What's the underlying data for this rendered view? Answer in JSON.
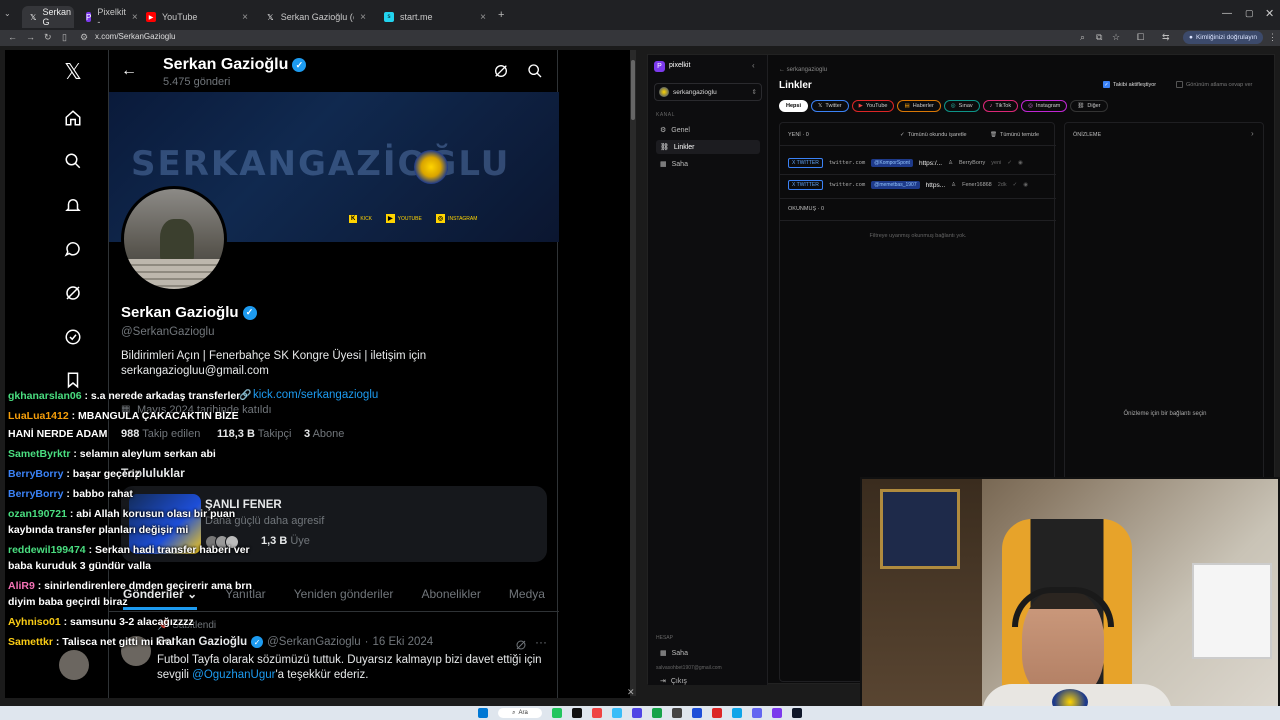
{
  "browser": {
    "tabs": [
      {
        "label": "Serkan G",
        "icon": "x-icon",
        "color": "#ffffff"
      },
      {
        "label": "Pixelkit -",
        "icon": "pixelkit-icon",
        "color": "#7c3aed"
      },
      {
        "label": "YouTube",
        "icon": "youtube-icon",
        "color": "#ff0000"
      },
      {
        "label": "Serkan Gazioğlu (@SerkanGazi",
        "icon": "x-icon",
        "color": "#ffffff"
      },
      {
        "label": "start.me",
        "icon": "startme-icon",
        "color": "#22d3ee"
      }
    ],
    "url": "x.com/SerkanGazioglu",
    "verify_label": "Kimliğinizi doğrulayın"
  },
  "profile": {
    "header_name": "Serkan Gazioğlu",
    "post_count": "5.475 gönderi",
    "banner_text": "SERKANGAZİOĞLU",
    "banner_socials": [
      "KICK",
      "YOUTUBE",
      "INSTAGRAM"
    ],
    "name": "Serkan Gazioğlu",
    "handle": "@SerkanGazioglu",
    "bio_line1": "Bildirimleri Açın | Fenerbahçe SK Kongre Üyesi | iletişim için",
    "bio_line2": "serkangaziogluu@gmail.com",
    "link": "kick.com/serkangazioglu",
    "joined": "Mayıs 2024 tarihinde katıldı",
    "following_count": "988",
    "following_label": "Takip edilen",
    "followers_count": "118,3 B",
    "followers_label": "Takipçi",
    "subs_count": "3",
    "subs_label": "Abone",
    "communities_label": "Topluluklar",
    "community_name": "ŞANLI FENER",
    "community_desc": "Daha güçlü daha agresif",
    "community_members": "1,3 B",
    "community_members_label": "Üye",
    "tabs": [
      "Gönderiler",
      "Yanıtlar",
      "Yeniden gönderiler",
      "Abonelikler",
      "Medya"
    ],
    "pinned_label": "Sabitlendi",
    "tweet_author": "Serkan Gazioğlu",
    "tweet_handle": "@SerkanGazioglu",
    "tweet_date": "16 Eki 2024",
    "tweet_line1": "Futbol Tayfa olarak sözümüzü tuttuk. Duyarsız kalmayıp bizi davet ettiği için",
    "tweet_line2_pre": "sevgili",
    "tweet_mention": "@OguzhanUgur",
    "tweet_line2_post": "'a teşekkür ederiz."
  },
  "chat": [
    {
      "user": "gkhanarslan06",
      "color": "#4ade80",
      "msg": ": s.a nerede arkadaş transferler"
    },
    {
      "user": "LuaLua1412",
      "color": "#f59e0b",
      "msg": ": MBANGULA ÇAKACAKTIN BİZE"
    },
    {
      "user": "",
      "color": "#ffffff",
      "msg": "HANİ NERDE ADAM"
    },
    {
      "user": "SametByrktr",
      "color": "#4ade80",
      "msg": ": selamın aleylum serkan abi"
    },
    {
      "user": "BerryBorry",
      "color": "#3b82f6",
      "msg": ": başar geçeriz"
    },
    {
      "user": "BerryBorry",
      "color": "#3b82f6",
      "msg": ": babbo rahat"
    },
    {
      "user": "ozan190721",
      "color": "#4ade80",
      "msg": ": abi Allah korusun olası bir puan"
    },
    {
      "user": "",
      "color": "#ffffff",
      "msg": "kaybında transfer planları değişir mi"
    },
    {
      "user": "reddewil199474",
      "color": "#4ade80",
      "msg": ": Serkan hadi transfer haberi ver"
    },
    {
      "user": "",
      "color": "#ffffff",
      "msg": "baba kuruduk 3 gündür valla"
    },
    {
      "user": "AliR9",
      "color": "#f472b6",
      "msg": ": sinirlendirenlere dmden geçirerir ama brn"
    },
    {
      "user": "",
      "color": "#ffffff",
      "msg": "diyim baba geçirdi biraz"
    },
    {
      "user": "Ayhniso01",
      "color": "#facc15",
      "msg": ": samsunu 3-2 alacağızzzz"
    },
    {
      "user": "Samettkr",
      "color": "#facc15",
      "msg": ": Talisca net gitti mi kral"
    }
  ],
  "pixelkit": {
    "app_name": "pixelkit",
    "account": "serkangazioglu",
    "section_kanal": "KANAL",
    "nav": [
      "Genel",
      "Linkler",
      "Saha"
    ],
    "section_hesap": "HESAP",
    "bottom_nav": [
      "Saha",
      "Çıkış"
    ],
    "email": "salvasohbet1907@gmail.com",
    "breadcrumb": "← serkangazioglu",
    "title": "Linkler",
    "toggle1": "Takibi aktifleştiyor",
    "toggle2": "Görünüm atlama cevap ver",
    "filters": [
      "Hepsi",
      "Twitter",
      "YouTube",
      "Haberler",
      "Sınav",
      "TikTok",
      "Instagram",
      "Diğer"
    ],
    "new_label": "YENİ · 0",
    "mark_all": "Tümünü okundu işaretle",
    "clear_all": "Tümünü temizle",
    "rows": [
      {
        "badge": "X TWITTER",
        "domain": "twitter.com",
        "handle": "@KomporSpont",
        "url": "https:/...",
        "user": "BerryBorry",
        "time": "yeni"
      },
      {
        "badge": "X TWITTER",
        "domain": "twitter.com",
        "handle": "@memetbas_1907",
        "url": "https...",
        "user": "Fener16868",
        "time": "2dk"
      }
    ],
    "read_label": "OKUNMUŞ · 0",
    "empty_msg": "Filtreye uyanmış okunmuş bağlantı yok.",
    "preview_label": "ÖNİZLEME",
    "preview_empty": "Önizleme için bir bağlantı seçin"
  },
  "taskbar": {
    "search": "Ara"
  }
}
